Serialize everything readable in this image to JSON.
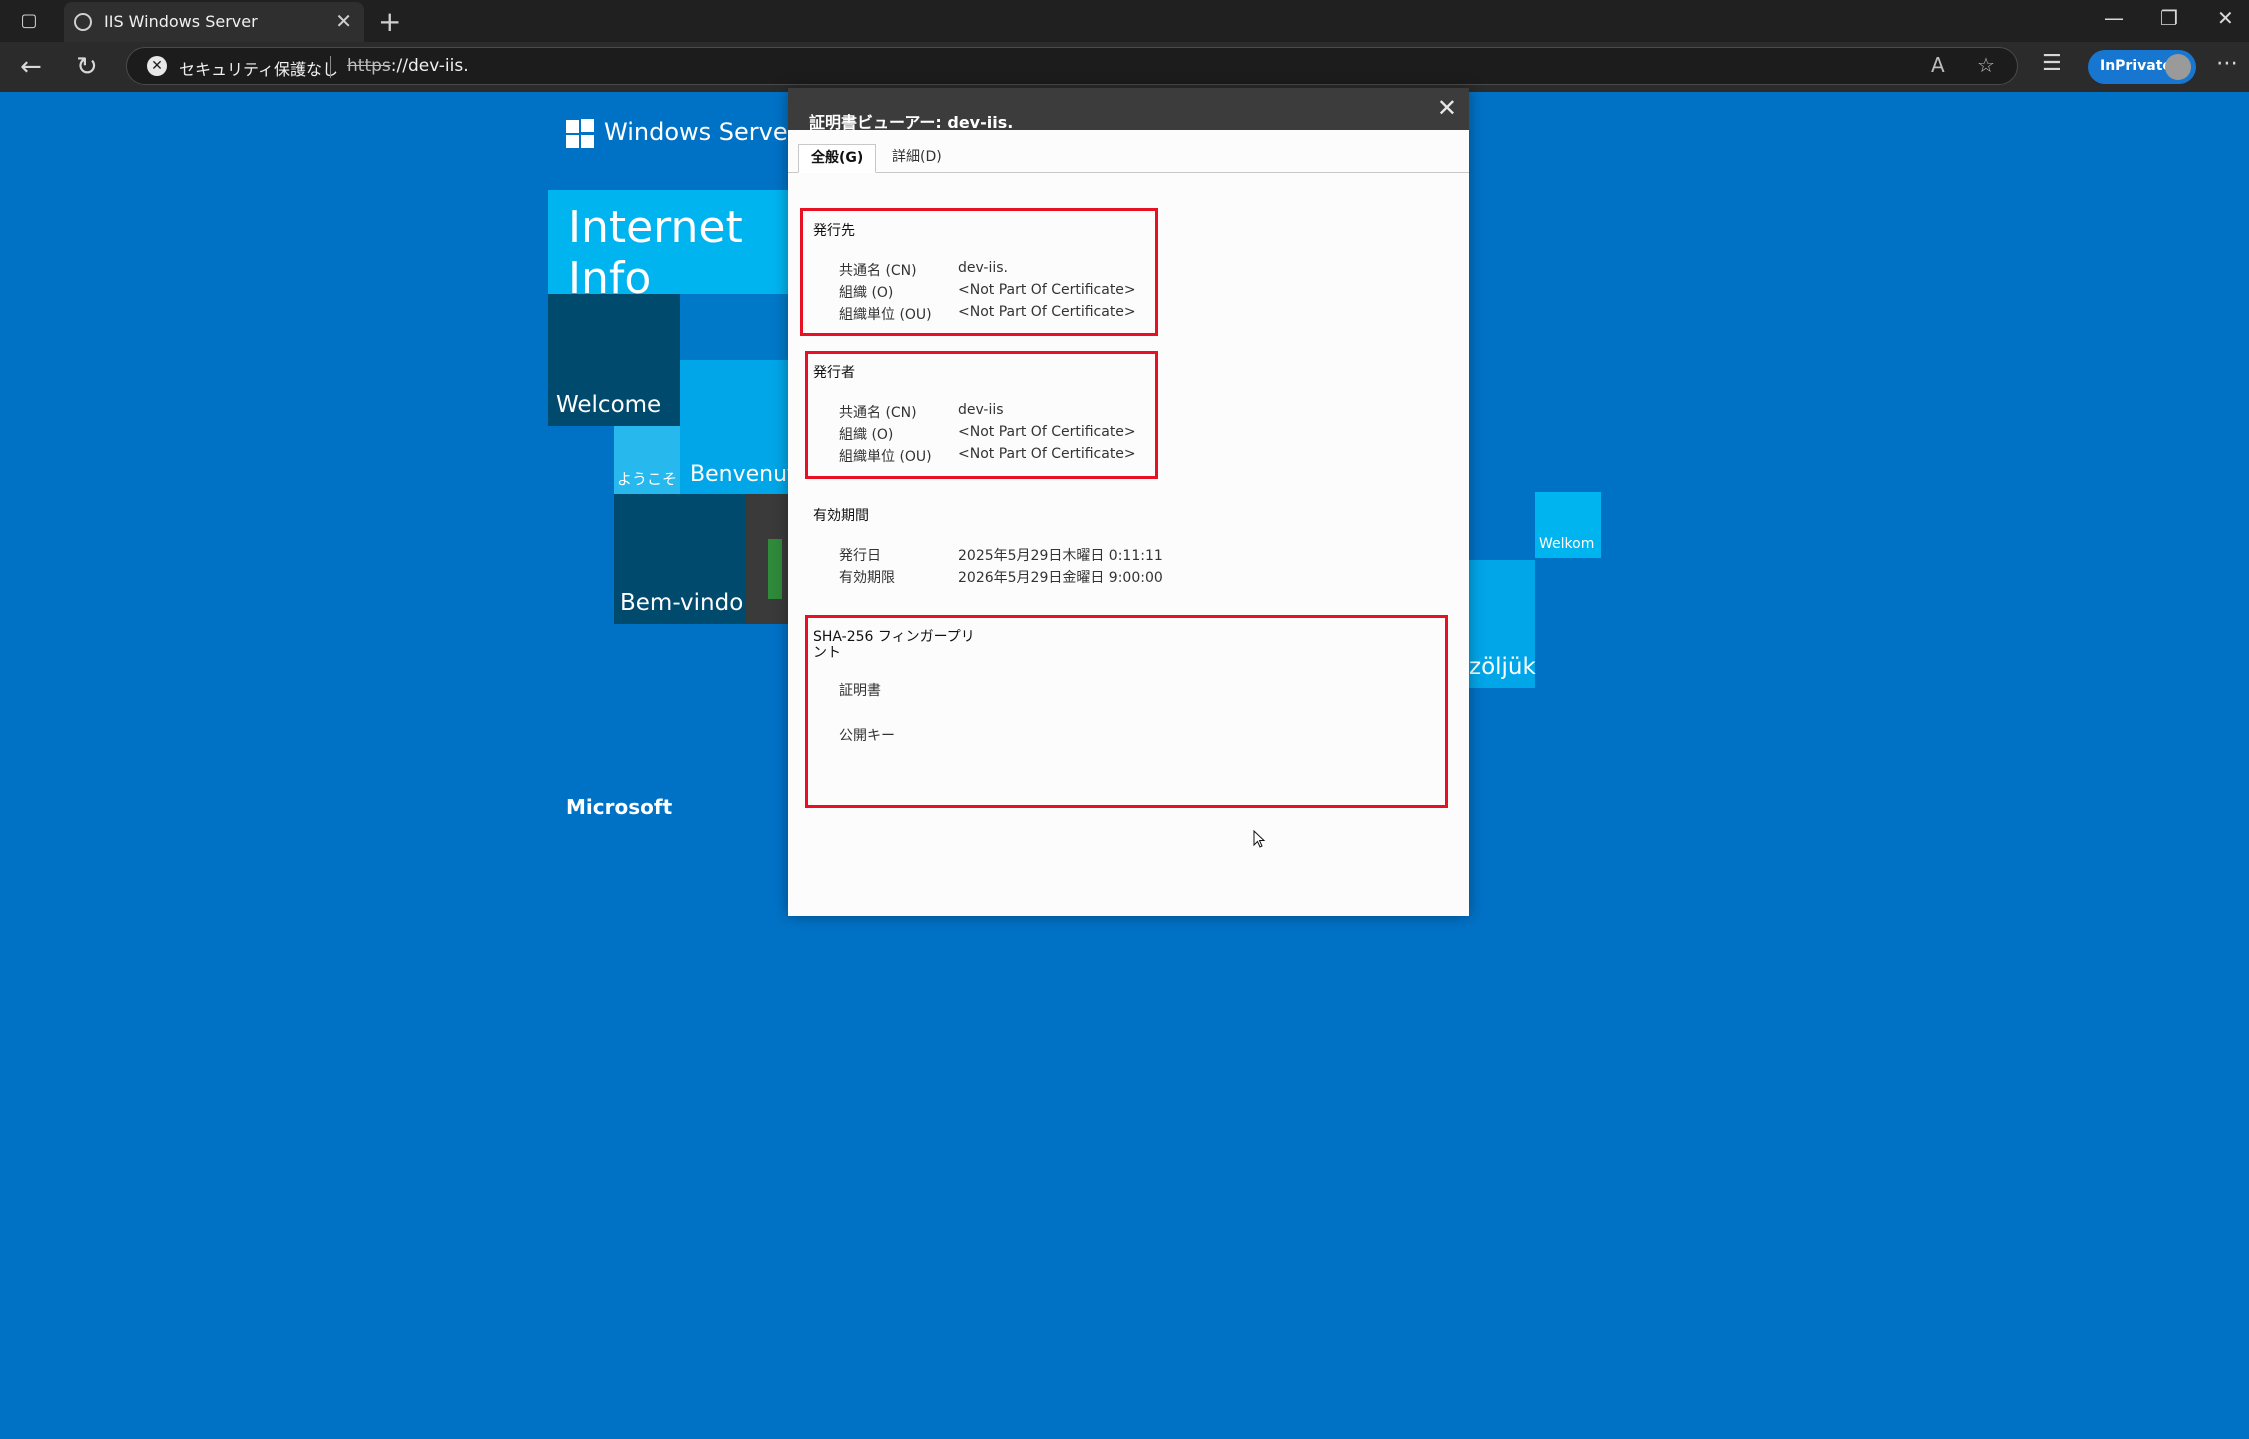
{
  "browser": {
    "tab_title": "IIS Windows Server",
    "security_label": "セキュリティ保護なし",
    "url_scheme": "https",
    "url_rest": "://dev-iis.",
    "inprivate_label": "InPrivate"
  },
  "page": {
    "product_name": "Windows Server",
    "banner_text": "Internet Info",
    "tiles": [
      "Welcome",
      "ようこそ",
      "Benvenut",
      "Bem-vindo",
      "Welkom",
      "zöljük"
    ],
    "footer": "Microsoft"
  },
  "dialog": {
    "title": "証明書ビューアー: dev-iis.",
    "tabs": [
      "全般(G)",
      "詳細(D)"
    ],
    "issued_to": {
      "title": "発行先",
      "rows": [
        {
          "label": "共通名 (CN)",
          "value": "dev-iis."
        },
        {
          "label": "組織 (O)",
          "value": "<Not Part Of Certificate>"
        },
        {
          "label": "組織単位 (OU)",
          "value": "<Not Part Of Certificate>"
        }
      ]
    },
    "issued_by": {
      "title": "発行者",
      "rows": [
        {
          "label": "共通名 (CN)",
          "value": "dev-iis"
        },
        {
          "label": "組織 (O)",
          "value": "<Not Part Of Certificate>"
        },
        {
          "label": "組織単位 (OU)",
          "value": "<Not Part Of Certificate>"
        }
      ]
    },
    "validity": {
      "title": "有効期間",
      "rows": [
        {
          "label": "発行日",
          "value": "2025年5月29日木曜日 0:11:11"
        },
        {
          "label": "有効期限",
          "value": "2026年5月29日金曜日 9:00:00"
        }
      ]
    },
    "fingerprints": {
      "title_line1": "SHA-256 フィンガープリ",
      "title_line2": "ント",
      "rows": [
        {
          "label": "証明書"
        },
        {
          "label": "公開キー"
        }
      ]
    }
  },
  "colors": {
    "page_bg": "#0072c6",
    "highlight": "#e81123"
  }
}
